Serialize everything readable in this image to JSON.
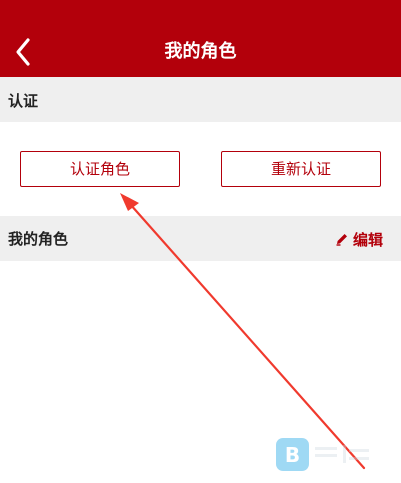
{
  "header": {
    "title": "我的角色",
    "back_icon": "chevron-left-icon",
    "background_color": "#b3000b"
  },
  "certification": {
    "section_title": "认证",
    "certify_button_label": "认证角色",
    "recertify_button_label": "重新认证"
  },
  "my_roles": {
    "section_title": "我的角色",
    "edit_label": "编辑",
    "edit_icon": "pencil-icon"
  },
  "annotation": {
    "arrow_color": "#f03a2e",
    "arrow_icon": "arrow-annotation-icon"
  },
  "colors": {
    "accent": "#b3000b",
    "section_background": "#efefef",
    "page_background": "#ffffff"
  }
}
